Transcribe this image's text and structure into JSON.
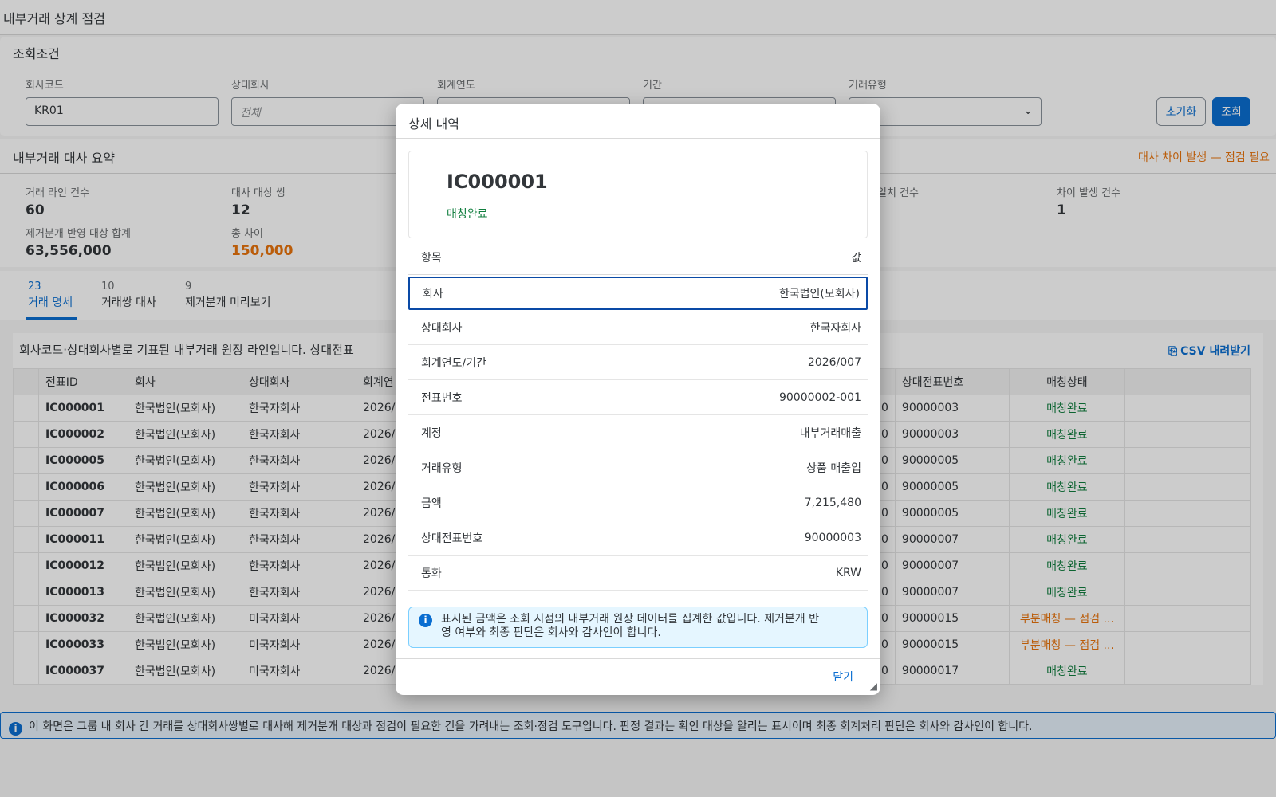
{
  "page": {
    "title": "내부거래 상계 점검"
  },
  "filters": {
    "title": "조회조건",
    "fields": [
      {
        "label": "회사코드",
        "value": "KR01"
      },
      {
        "label": "상대회사",
        "placeholder": "전체"
      },
      {
        "label": "회계연도",
        "value": ""
      },
      {
        "label": "기간",
        "value": ""
      },
      {
        "label": "거래유형",
        "value": ""
      }
    ],
    "reset_label": "초기화",
    "search_label": "조회"
  },
  "summary": {
    "title": "내부거래 대사 요약",
    "alert": "대사 차이 발생 — 점검 필요",
    "kpis": [
      {
        "label": "거래 라인 건수",
        "value": "60"
      },
      {
        "label": "대사 대상 쌍",
        "value": "12"
      },
      {
        "label": "일치 건수",
        "value": ""
      },
      {
        "label": "차이 발생 건수",
        "value": "1"
      },
      {
        "label": "제거분개 반영 대상 합계",
        "value": "63,556,000"
      },
      {
        "label": "총 차이",
        "value": "150,000"
      }
    ]
  },
  "tabs": [
    {
      "count": "23",
      "label": "거래 명세"
    },
    {
      "count": "10",
      "label": "거래쌍 대사"
    },
    {
      "count": "9",
      "label": "제거분개 미리보기"
    }
  ],
  "table": {
    "description": "회사코드·상대회사별로 기표된 내부거래 원장 라인입니다. 상대전표",
    "csv_label": "CSV 내려받기",
    "columns": [
      "전표ID",
      "회사",
      "상대회사",
      "회계연",
      "",
      "상대전표번호",
      "매칭상태"
    ],
    "rows": [
      {
        "id": "IC000001",
        "company": "한국법인(모회사)",
        "counterparty": "한국자회사",
        "year": "2026/0",
        "amt": "0",
        "cp_doc": "90000003",
        "status": "매칭완료",
        "warn": false
      },
      {
        "id": "IC000002",
        "company": "한국법인(모회사)",
        "counterparty": "한국자회사",
        "year": "2026/0",
        "amt": "0",
        "cp_doc": "90000003",
        "status": "매칭완료",
        "warn": false
      },
      {
        "id": "IC000005",
        "company": "한국법인(모회사)",
        "counterparty": "한국자회사",
        "year": "2026/0",
        "amt": "0",
        "cp_doc": "90000005",
        "status": "매칭완료",
        "warn": false
      },
      {
        "id": "IC000006",
        "company": "한국법인(모회사)",
        "counterparty": "한국자회사",
        "year": "2026/0",
        "amt": "0",
        "cp_doc": "90000005",
        "status": "매칭완료",
        "warn": false
      },
      {
        "id": "IC000007",
        "company": "한국법인(모회사)",
        "counterparty": "한국자회사",
        "year": "2026/0",
        "amt": "0",
        "cp_doc": "90000005",
        "status": "매칭완료",
        "warn": false
      },
      {
        "id": "IC000011",
        "company": "한국법인(모회사)",
        "counterparty": "한국자회사",
        "year": "2026/0",
        "amt": "0",
        "cp_doc": "90000007",
        "status": "매칭완료",
        "warn": false
      },
      {
        "id": "IC000012",
        "company": "한국법인(모회사)",
        "counterparty": "한국자회사",
        "year": "2026/0",
        "amt": "0",
        "cp_doc": "90000007",
        "status": "매칭완료",
        "warn": false
      },
      {
        "id": "IC000013",
        "company": "한국법인(모회사)",
        "counterparty": "한국자회사",
        "year": "2026/0",
        "amt": "0",
        "cp_doc": "90000007",
        "status": "매칭완료",
        "warn": false
      },
      {
        "id": "IC000032",
        "company": "한국법인(모회사)",
        "counterparty": "미국자회사",
        "year": "2026/0",
        "amt": "0",
        "cp_doc": "90000015",
        "status": "부분매칭 — 점검 ...",
        "warn": true
      },
      {
        "id": "IC000033",
        "company": "한국법인(모회사)",
        "counterparty": "미국자회사",
        "year": "2026/0",
        "amt": "0",
        "cp_doc": "90000015",
        "status": "부분매칭 — 점검 ...",
        "warn": true
      },
      {
        "id": "IC000037",
        "company": "한국법인(모회사)",
        "counterparty": "미국자회사",
        "year": "2026/0",
        "amt": "0",
        "cp_doc": "90000017",
        "status": "매칭완료",
        "warn": false
      }
    ]
  },
  "footer_note": "이 화면은 그룹 내 회사 간 거래를 상대회사쌍별로 대사해 제거분개 대상과 점검이 필요한 건을 가려내는 조회·점검 도구입니다. 판정 결과는 확인 대상을 알리는 표시이며 최종 회계처리 판단은 회사와 감사인이 합니다.",
  "dialog": {
    "title": "상세 내역",
    "record_id": "IC000001",
    "record_status": "매칭완료",
    "col_item": "항목",
    "col_value": "값",
    "rows": [
      {
        "label": "회사",
        "value": "한국법인(모회사)"
      },
      {
        "label": "상대회사",
        "value": "한국자회사"
      },
      {
        "label": "회계연도/기간",
        "value": "2026/007"
      },
      {
        "label": "전표번호",
        "value": "90000002-001"
      },
      {
        "label": "계정",
        "value": "내부거래매출"
      },
      {
        "label": "거래유형",
        "value": "상품 매출입"
      },
      {
        "label": "금액",
        "value": "7,215,480"
      },
      {
        "label": "상대전표번호",
        "value": "90000003"
      },
      {
        "label": "통화",
        "value": "KRW"
      }
    ],
    "info_line1": "표시된 금액은 조회 시점의 내부거래 원장 데이터를 집계한 값입니다. 제거분개 반",
    "info_line2": "영 여부와 최종 판단은 회사와 감사인이 합니다.",
    "close_label": "닫기"
  },
  "colors": {
    "accent": "#0a6ed1",
    "ok": "#107e3e",
    "warn": "#e9730c"
  }
}
